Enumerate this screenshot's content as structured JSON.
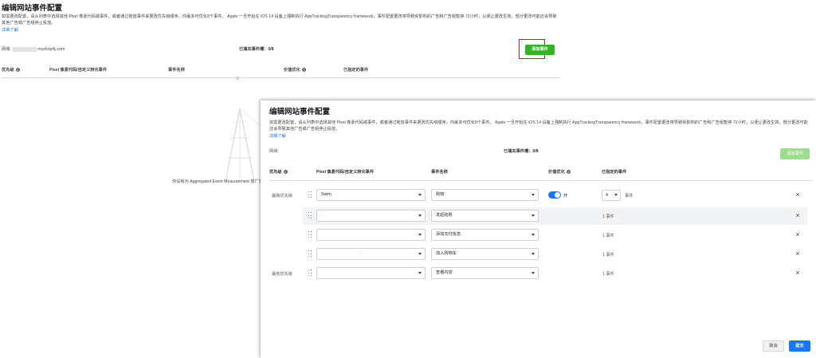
{
  "background": {
    "title": "编辑网站事件配置",
    "description": "如需更改配置，请从列表中选择其他 Pixel 像素代码或事件，或者通过拖放事件来更改优先级顺序。你最多可优化8个事件。 Apple 一旦开始在 iOS 14 设备上强制执行 AppTrackingTransparency framework，事件配置更改将导致受影响的广告和广告组暂停 72小时，以便让更改生效。部分更改可能还会导致其他广告或广告组停止投放。",
    "learn_more": "详细了解",
    "domain_label": "网域:",
    "domain_value": "myshopify.com",
    "configured": "已填充事件槽：0/8",
    "add_button": "添加事件",
    "headers": {
      "priority": "优先级",
      "pixel": "Pixel 像素代码/自定义转化事件",
      "event_name": "事件名称",
      "value_opt": "价值优化",
      "assigned": "已指定的事件"
    },
    "empty_text": "你没有为 Aggregated Event Measurement 放广告。"
  },
  "dialog": {
    "title": "编辑网站事件配置",
    "description": "如需更改配置，请从列表中选择其他 Pixel 像素代码或事件，或者通过拖放事件来更改优先级顺序。你最多可优化8个事件。 Apple 一旦开始在 iOS 14 设备上强制执行 AppTrackingTransparency framework，事件配置更改将导致受影响的广告和广告组暂停 72小时，以便让更改生效。部分更改可能还会导致其他广告或广告组停止投放。",
    "learn_more": "详细了解",
    "domain_label": "网域:",
    "configured": "已填充事件槽：0/8",
    "add_button": "添加事件",
    "headers": {
      "priority": "优先级",
      "pixel": "Pixel 像素代码/自定义转化事件",
      "event_name": "事件名称",
      "value_opt": "价值优化",
      "assigned": "已指定的事件"
    },
    "rows": [
      {
        "priority_label": "最高优先级",
        "pixel": "Swim.",
        "event": "购物",
        "value_opt_on": true,
        "value_opt_label": "开",
        "count": "4",
        "count_suffix": "事件"
      },
      {
        "priority_label": "",
        "pixel": ".",
        "event": "发起结账",
        "count_text": "1 事件"
      },
      {
        "priority_label": "",
        "pixel": "",
        "event": "添加支付信息",
        "count_text": "1 事件"
      },
      {
        "priority_label": "",
        "pixel": ".",
        "event": "加入购物车",
        "count_text": "1 事件"
      },
      {
        "priority_label": "最低优先级",
        "pixel": "",
        "event": "查看内容",
        "count_text": "1 事件"
      }
    ],
    "cancel_button": "取消",
    "submit_button": "提交"
  },
  "colors": {
    "accent_blue": "#1877f2",
    "add_green": "#31b525",
    "add_green_disabled": "#9fdd8e",
    "highlight_red": "#e0181b"
  }
}
